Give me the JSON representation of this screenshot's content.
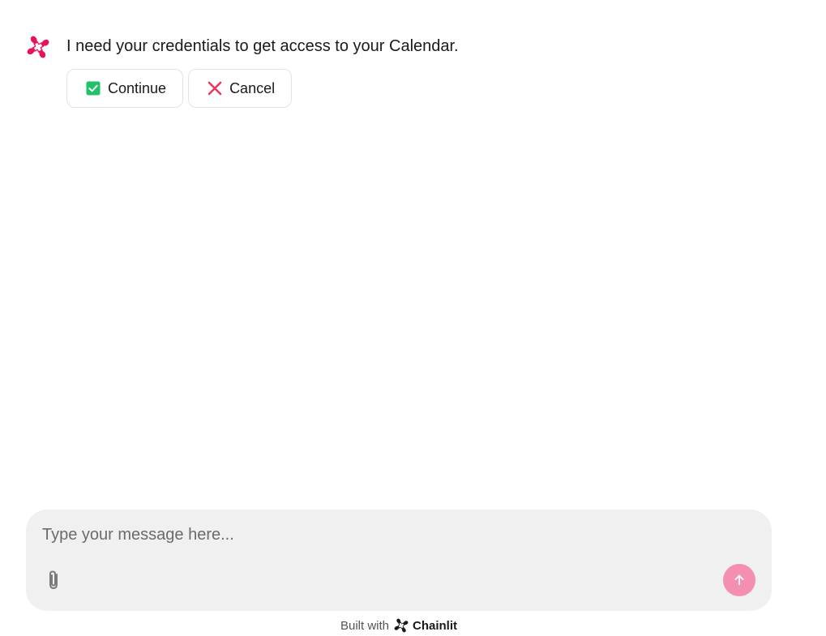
{
  "message": {
    "avatar_icon": "chainlit-logo-icon",
    "accent_color": "#e8125c",
    "text": "I need your credentials to get access to your Calendar.",
    "actions": [
      {
        "label": "Continue",
        "icon": "check-square-icon",
        "icon_color": "#1fc16b"
      },
      {
        "label": "Cancel",
        "icon": "close-x-icon",
        "icon_color": "#e8395d"
      }
    ]
  },
  "composer": {
    "placeholder": "Type your message here...",
    "attach_icon": "paperclip-icon",
    "send_icon": "arrow-up-icon",
    "send_color": "#f48fb1"
  },
  "footer": {
    "prefix": "Built with",
    "brand": "Chainlit",
    "brand_icon": "chainlit-logo-icon"
  }
}
